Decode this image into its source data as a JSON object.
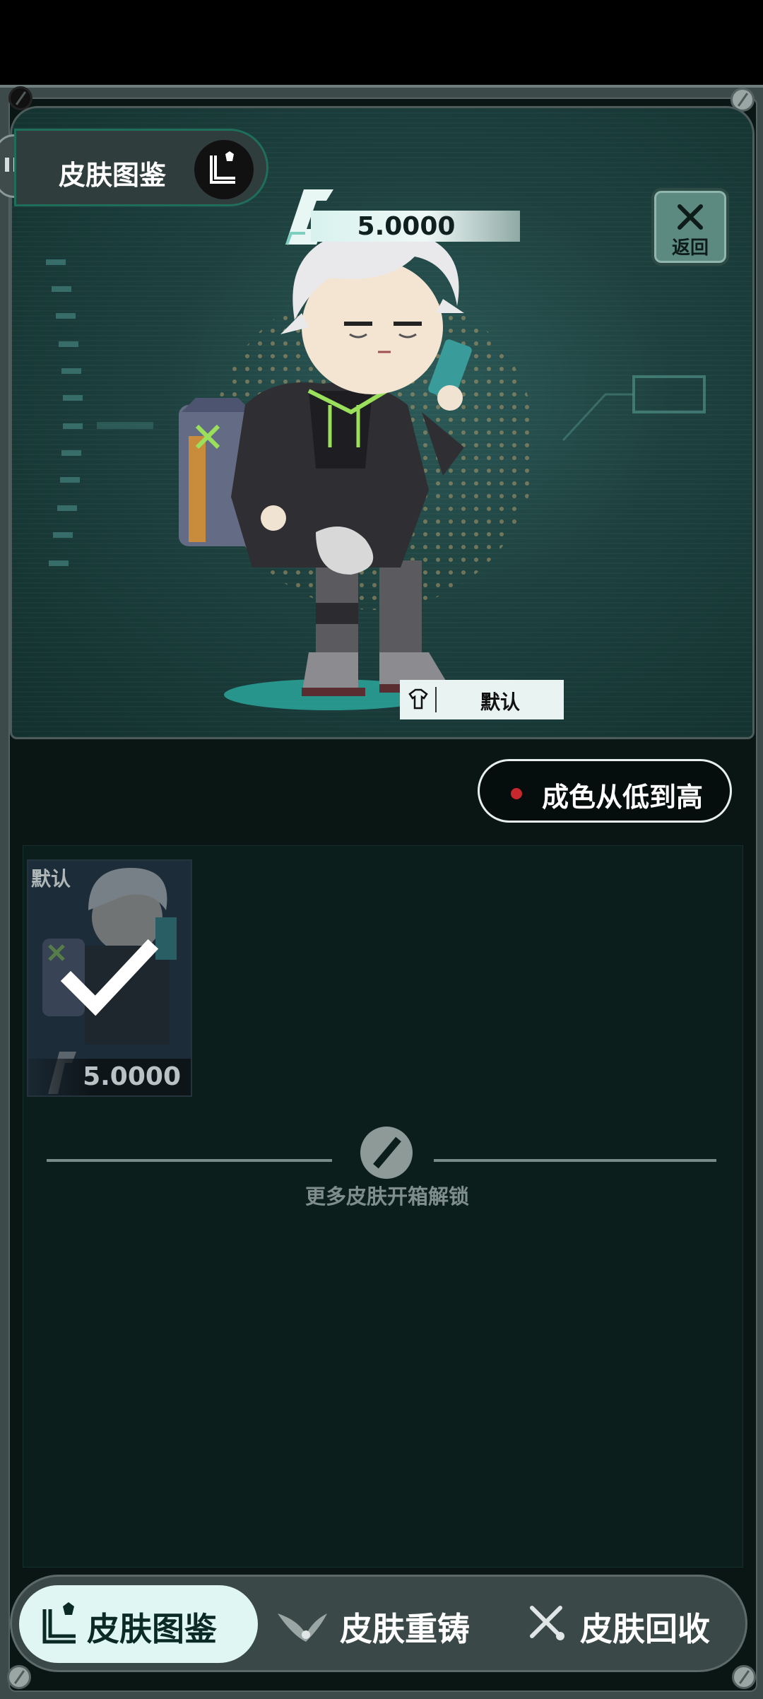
{
  "header": {
    "title": "皮肤图鉴",
    "back_label": "返回",
    "value": "5.0000"
  },
  "preview": {
    "skin_name": "默认"
  },
  "sort": {
    "label": "成色从低到高"
  },
  "skins": [
    {
      "label": "默认",
      "value": "5.0000",
      "selected": true
    }
  ],
  "more_hint": "更多皮肤开箱解锁",
  "tabs": [
    {
      "label": "皮肤图鉴",
      "icon": "skin-collection-icon",
      "active": true
    },
    {
      "label": "皮肤重铸",
      "icon": "recast-icon",
      "active": false
    },
    {
      "label": "皮肤回收",
      "icon": "tools-recycle-icon",
      "active": false
    }
  ],
  "colors": {
    "accent": "#dff6f2",
    "background": "#0a1614",
    "sort_dot": "#c7282d"
  }
}
